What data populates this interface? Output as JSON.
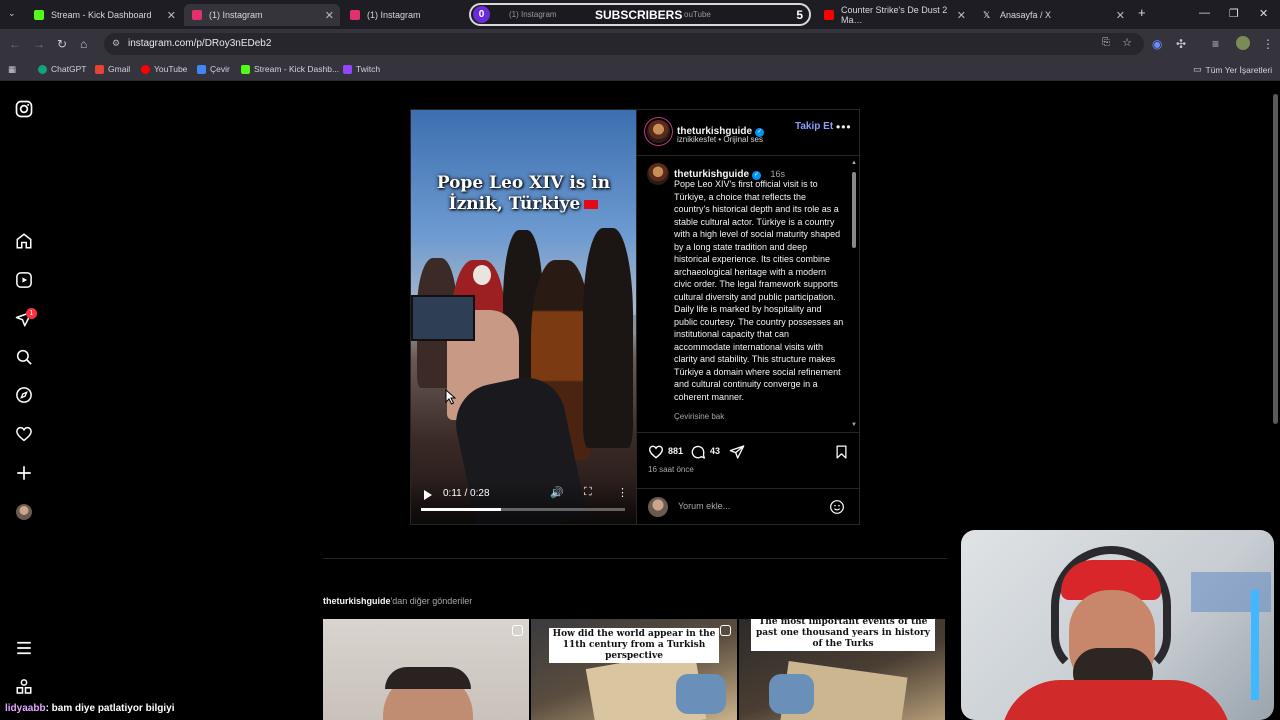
{
  "browser": {
    "tabs": [
      {
        "label": "Stream - Kick Dashboard",
        "color": "#53fc18"
      },
      {
        "label": "(1) Instagram",
        "color": "#e1306c",
        "active": true
      },
      {
        "label": "(1) Instagram",
        "color": "#e1306c"
      },
      {
        "label": "Counter Strike's De Dust 2 Ma…",
        "color": "#ff0000"
      },
      {
        "label": "Anasayfa / X",
        "color": "#ffffff"
      }
    ],
    "obscured_tab_labels": [
      "(1) Instagram",
      "ouTube"
    ],
    "url": "instagram.com/p/DRoy3nEDeb2",
    "bookmarks": [
      {
        "label": "ChatGPT",
        "color": "#10a37f"
      },
      {
        "label": "Gmail",
        "color": "#ea4335"
      },
      {
        "label": "YouTube",
        "color": "#ff0000"
      },
      {
        "label": "Çevir",
        "color": "#4285f4"
      },
      {
        "label": "Stream - Kick Dashb...",
        "color": "#53fc18"
      },
      {
        "label": "Twitch",
        "color": "#9146ff"
      }
    ],
    "all_bookmarks_label": "Tüm Yer İşaretleri"
  },
  "subscriber_overlay": {
    "count": "0",
    "label": "SUBSCRIBERS",
    "goal": "5"
  },
  "instagram": {
    "notification_count": "1",
    "post": {
      "video": {
        "overlay_title_line1": "Pope Leo XIV is in",
        "overlay_title_line2": "İznik, Türkiye",
        "time": "0:11 / 0:28",
        "progress": 0.39
      },
      "header": {
        "username": "theturkishguide",
        "location": "iznikikesfet",
        "audio": "Orijinal ses",
        "follow_label": "Takip Et"
      },
      "caption": {
        "username": "theturkishguide",
        "age": "16s",
        "text": "Pope Leo XIV's first official visit is to Türkiye, a choice that reflects the country's historical depth and its role as a stable cultural actor. Türkiye is a country with a high level of social maturity shaped by a long state tradition and deep historical experience. Its cities combine archaeological heritage with a modern civic order. The legal framework supports cultural diversity and public participation. Daily life is marked by hospitality and public courtesy. The country possesses an institutional capacity that can accommodate international visits with clarity and stability. This structure makes Türkiye a domain where social refinement and cultural continuity converge in a coherent manner.",
        "see_translation": "Çevirisine bak"
      },
      "likes": "881",
      "comments": "43",
      "posted_ago": "16 saat önce",
      "comment_placeholder": "Yorum ekle..."
    },
    "more_posts": {
      "username": "theturkishguide",
      "suffix": "'dan diğer gönderiler",
      "thumbs": [
        {
          "caption": ""
        },
        {
          "caption": "How did the world appear in the 11th century from a Turkish perspective"
        },
        {
          "caption": "The most important events of the past one thousand years in history of the Turks"
        }
      ]
    }
  },
  "stream_chat": {
    "user": "lidyaabb",
    "message": ": bam diye patlatiyor bilgiyi"
  }
}
